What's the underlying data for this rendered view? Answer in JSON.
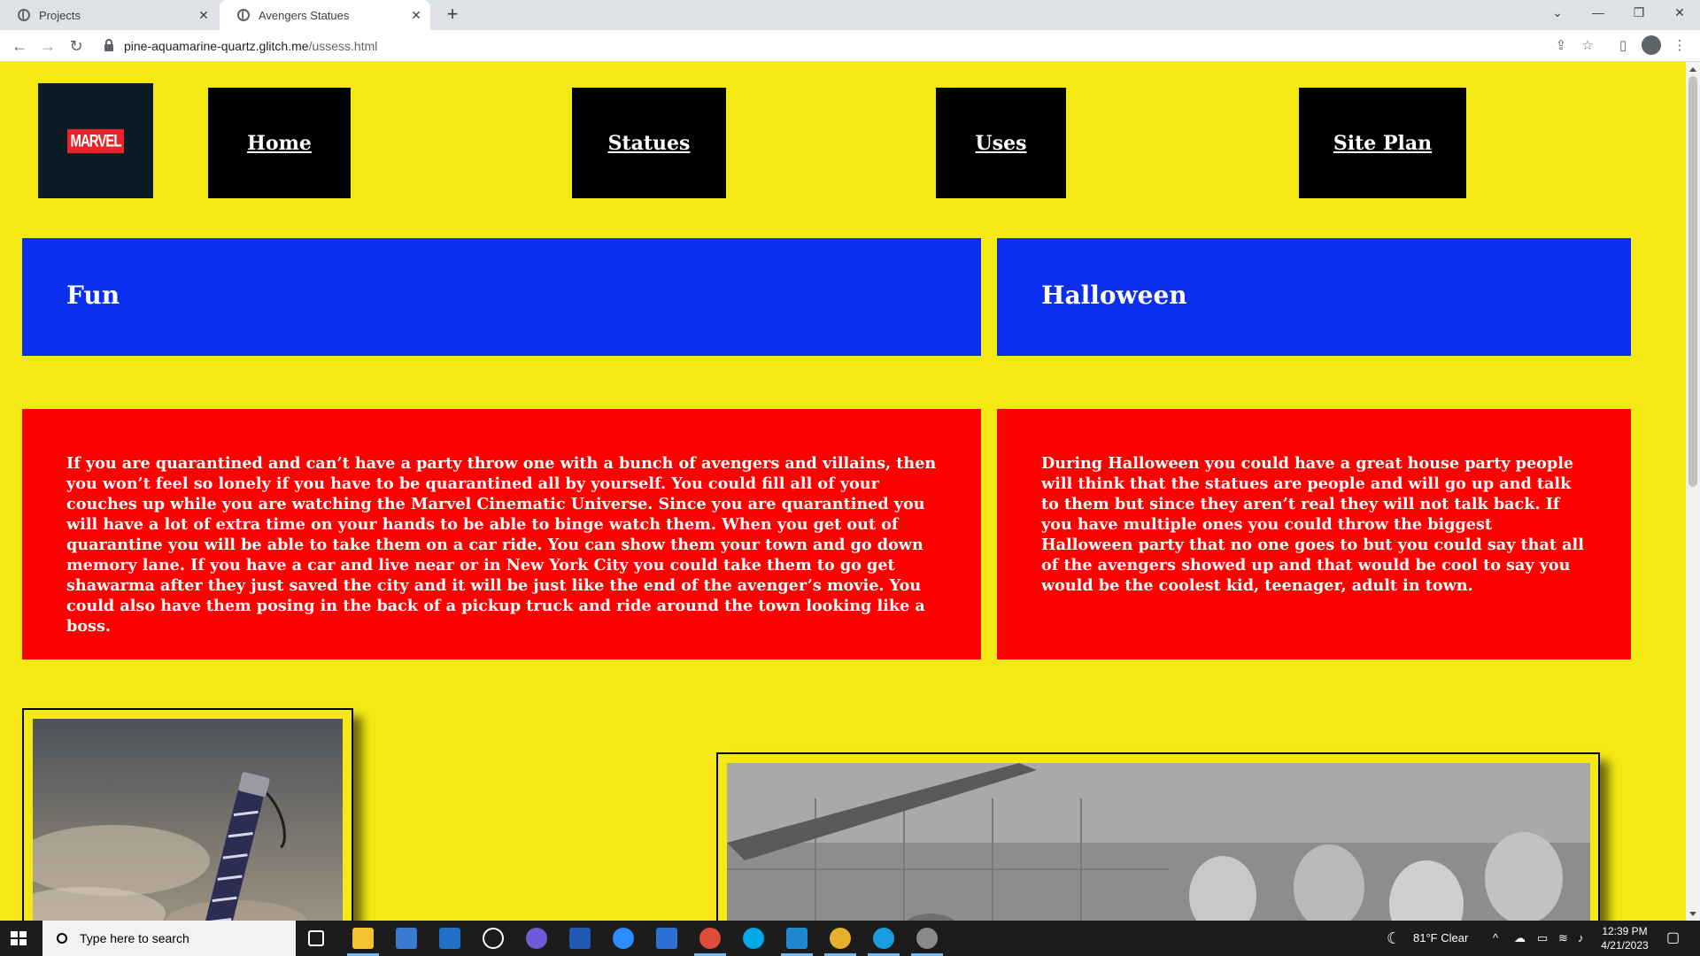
{
  "browser": {
    "tabs": [
      {
        "title": "Projects"
      },
      {
        "title": "Avengers Statues"
      }
    ],
    "new_tab_label": "+",
    "url_host": "pine-aquamarine-quartz.glitch.me",
    "url_path": "/ussess.html"
  },
  "site": {
    "logo_text": "MARVEL",
    "nav": [
      {
        "label": "Home"
      },
      {
        "label": "Statues"
      },
      {
        "label": "Uses"
      },
      {
        "label": "Site Plan"
      }
    ],
    "headings": {
      "left": "Fun",
      "right": "Halloween"
    },
    "paragraphs": {
      "left": "If you are quarantined and can’t have a party throw one with a bunch of avengers and villains, then you won’t feel so lonely if you have to be quarantined all by yourself. You could fill all of your couches up while you are watching the Marvel Cinematic Universe. Since you are quarantined you will have a lot of extra time on your hands to be able to binge watch them. When you get out of quarantine you will be able to take them on a car ride. You can show them your town and go down memory lane. If you have a car and live near or in New York City you could take them to go get shawarma after they just saved the city and it will be just like the end of the avenger’s movie. You could also have them posing in the back of a pickup truck and ride around the town looking like a boss.",
      "right": "During Halloween you could have a great house party people will think that the statues are people and will go up and talk to them but since they aren’t real they will not talk back. If you have multiple ones you could throw the biggest Halloween party that no one goes to but you could say that all of the avengers showed up and that would be cool to say you would be the coolest kid, teenager, adult in town."
    },
    "colors": {
      "page_bg": "#f4e815",
      "heading_bg": "#0c2eef",
      "paragraph_bg": "#fe0000",
      "nav_bg": "#000000"
    }
  },
  "taskbar": {
    "search_placeholder": "Type here to search",
    "weather": "81°F  Clear",
    "time": "12:39 PM",
    "date": "4/21/2023"
  }
}
